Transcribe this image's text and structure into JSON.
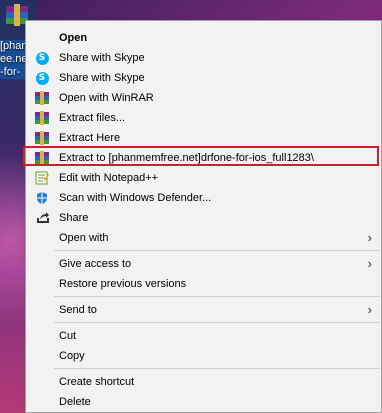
{
  "desktop": {
    "icon_label": "[phan\nee.ne\n-for-"
  },
  "menu": {
    "items": [
      {
        "label": "Open",
        "icon": "none",
        "bold": true
      },
      {
        "label": "Share with Skype",
        "icon": "skype-icon"
      },
      {
        "label": "Share with Skype",
        "icon": "skype-icon"
      },
      {
        "label": "Open with WinRAR",
        "icon": "winrar-icon"
      },
      {
        "label": "Extract files...",
        "icon": "winrar-icon"
      },
      {
        "label": "Extract Here",
        "icon": "winrar-icon"
      },
      {
        "label": "Extract to [phanmemfree.net]drfone-for-ios_full1283\\",
        "icon": "winrar-icon"
      },
      {
        "label": "Edit with Notepad++",
        "icon": "notepad-plus-plus-icon"
      },
      {
        "label": "Scan with Windows Defender...",
        "icon": "windows-defender-icon"
      },
      {
        "label": "Share",
        "icon": "share-icon"
      },
      {
        "label": "Open with",
        "icon": "none",
        "submenu": true
      },
      {
        "label": "Give access to",
        "icon": "none",
        "submenu": true
      },
      {
        "label": "Restore previous versions",
        "icon": "none"
      },
      {
        "label": "Send to",
        "icon": "none",
        "submenu": true
      },
      {
        "label": "Cut",
        "icon": "none"
      },
      {
        "label": "Copy",
        "icon": "none"
      },
      {
        "label": "Create shortcut",
        "icon": "none"
      },
      {
        "label": "Delete",
        "icon": "none"
      }
    ],
    "submenu_arrow": "›",
    "highlight_color": "#d21f2a"
  }
}
